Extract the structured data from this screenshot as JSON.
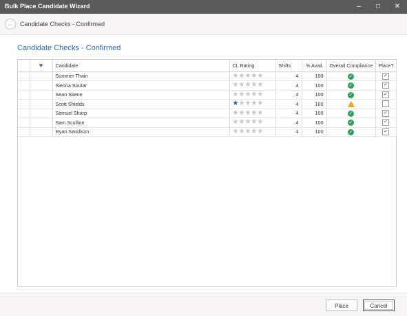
{
  "window": {
    "title": "Bulk Place Candidate Wizard",
    "min_glyph": "–",
    "max_glyph": "□",
    "close_glyph": "✕"
  },
  "nav": {
    "back_glyph": "←",
    "title": "Candidate Checks - Confirmed"
  },
  "page": {
    "heading": "Candidate Checks - Confirmed"
  },
  "grid": {
    "columns": [
      "Candidate",
      "CL Rating",
      "Shifts",
      "% Avail.",
      "Overall Compliance",
      "Place?"
    ],
    "favourite_glyph": "♥",
    "rows": [
      {
        "candidate": "Summer Thain",
        "rating": 0,
        "shifts": "4",
        "avail": "100",
        "compliance": "ok",
        "place": true
      },
      {
        "candidate": "Sienna Soutar",
        "rating": 0,
        "shifts": "4",
        "avail": "100",
        "compliance": "ok",
        "place": true
      },
      {
        "candidate": "Sean Skene",
        "rating": 0,
        "shifts": "4",
        "avail": "100",
        "compliance": "ok",
        "place": true
      },
      {
        "candidate": "Scott Shields",
        "rating": 1,
        "shifts": "4",
        "avail": "100",
        "compliance": "warning",
        "place": false
      },
      {
        "candidate": "Samuel Sharp",
        "rating": 0,
        "shifts": "4",
        "avail": "100",
        "compliance": "ok",
        "place": true
      },
      {
        "candidate": "Sam Scullion",
        "rating": 0,
        "shifts": "4",
        "avail": "100",
        "compliance": "ok",
        "place": true
      },
      {
        "candidate": "Ryan Sandison",
        "rating": 0,
        "shifts": "4",
        "avail": "100",
        "compliance": "ok",
        "place": true
      }
    ],
    "max_rating": 5
  },
  "footer": {
    "place_label": "Place",
    "cancel_label": "Cancel"
  },
  "colors": {
    "accent": "#2a6fb8",
    "ok": "#2e9e5b",
    "warning": "#f4a31a",
    "star_on": "#1f5fbf",
    "star_off": "#c6c6c6"
  }
}
